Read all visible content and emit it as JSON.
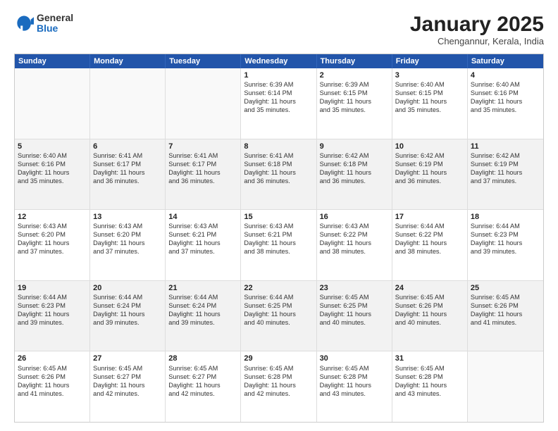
{
  "logo": {
    "general": "General",
    "blue": "Blue"
  },
  "header": {
    "month": "January 2025",
    "location": "Chengannur, Kerala, India"
  },
  "weekdays": [
    "Sunday",
    "Monday",
    "Tuesday",
    "Wednesday",
    "Thursday",
    "Friday",
    "Saturday"
  ],
  "rows": [
    [
      {
        "day": "",
        "info": ""
      },
      {
        "day": "",
        "info": ""
      },
      {
        "day": "",
        "info": ""
      },
      {
        "day": "1",
        "info": "Sunrise: 6:39 AM\nSunset: 6:14 PM\nDaylight: 11 hours\nand 35 minutes."
      },
      {
        "day": "2",
        "info": "Sunrise: 6:39 AM\nSunset: 6:15 PM\nDaylight: 11 hours\nand 35 minutes."
      },
      {
        "day": "3",
        "info": "Sunrise: 6:40 AM\nSunset: 6:15 PM\nDaylight: 11 hours\nand 35 minutes."
      },
      {
        "day": "4",
        "info": "Sunrise: 6:40 AM\nSunset: 6:16 PM\nDaylight: 11 hours\nand 35 minutes."
      }
    ],
    [
      {
        "day": "5",
        "info": "Sunrise: 6:40 AM\nSunset: 6:16 PM\nDaylight: 11 hours\nand 35 minutes."
      },
      {
        "day": "6",
        "info": "Sunrise: 6:41 AM\nSunset: 6:17 PM\nDaylight: 11 hours\nand 36 minutes."
      },
      {
        "day": "7",
        "info": "Sunrise: 6:41 AM\nSunset: 6:17 PM\nDaylight: 11 hours\nand 36 minutes."
      },
      {
        "day": "8",
        "info": "Sunrise: 6:41 AM\nSunset: 6:18 PM\nDaylight: 11 hours\nand 36 minutes."
      },
      {
        "day": "9",
        "info": "Sunrise: 6:42 AM\nSunset: 6:18 PM\nDaylight: 11 hours\nand 36 minutes."
      },
      {
        "day": "10",
        "info": "Sunrise: 6:42 AM\nSunset: 6:19 PM\nDaylight: 11 hours\nand 36 minutes."
      },
      {
        "day": "11",
        "info": "Sunrise: 6:42 AM\nSunset: 6:19 PM\nDaylight: 11 hours\nand 37 minutes."
      }
    ],
    [
      {
        "day": "12",
        "info": "Sunrise: 6:43 AM\nSunset: 6:20 PM\nDaylight: 11 hours\nand 37 minutes."
      },
      {
        "day": "13",
        "info": "Sunrise: 6:43 AM\nSunset: 6:20 PM\nDaylight: 11 hours\nand 37 minutes."
      },
      {
        "day": "14",
        "info": "Sunrise: 6:43 AM\nSunset: 6:21 PM\nDaylight: 11 hours\nand 37 minutes."
      },
      {
        "day": "15",
        "info": "Sunrise: 6:43 AM\nSunset: 6:21 PM\nDaylight: 11 hours\nand 38 minutes."
      },
      {
        "day": "16",
        "info": "Sunrise: 6:43 AM\nSunset: 6:22 PM\nDaylight: 11 hours\nand 38 minutes."
      },
      {
        "day": "17",
        "info": "Sunrise: 6:44 AM\nSunset: 6:22 PM\nDaylight: 11 hours\nand 38 minutes."
      },
      {
        "day": "18",
        "info": "Sunrise: 6:44 AM\nSunset: 6:23 PM\nDaylight: 11 hours\nand 39 minutes."
      }
    ],
    [
      {
        "day": "19",
        "info": "Sunrise: 6:44 AM\nSunset: 6:23 PM\nDaylight: 11 hours\nand 39 minutes."
      },
      {
        "day": "20",
        "info": "Sunrise: 6:44 AM\nSunset: 6:24 PM\nDaylight: 11 hours\nand 39 minutes."
      },
      {
        "day": "21",
        "info": "Sunrise: 6:44 AM\nSunset: 6:24 PM\nDaylight: 11 hours\nand 39 minutes."
      },
      {
        "day": "22",
        "info": "Sunrise: 6:44 AM\nSunset: 6:25 PM\nDaylight: 11 hours\nand 40 minutes."
      },
      {
        "day": "23",
        "info": "Sunrise: 6:45 AM\nSunset: 6:25 PM\nDaylight: 11 hours\nand 40 minutes."
      },
      {
        "day": "24",
        "info": "Sunrise: 6:45 AM\nSunset: 6:26 PM\nDaylight: 11 hours\nand 40 minutes."
      },
      {
        "day": "25",
        "info": "Sunrise: 6:45 AM\nSunset: 6:26 PM\nDaylight: 11 hours\nand 41 minutes."
      }
    ],
    [
      {
        "day": "26",
        "info": "Sunrise: 6:45 AM\nSunset: 6:26 PM\nDaylight: 11 hours\nand 41 minutes."
      },
      {
        "day": "27",
        "info": "Sunrise: 6:45 AM\nSunset: 6:27 PM\nDaylight: 11 hours\nand 42 minutes."
      },
      {
        "day": "28",
        "info": "Sunrise: 6:45 AM\nSunset: 6:27 PM\nDaylight: 11 hours\nand 42 minutes."
      },
      {
        "day": "29",
        "info": "Sunrise: 6:45 AM\nSunset: 6:28 PM\nDaylight: 11 hours\nand 42 minutes."
      },
      {
        "day": "30",
        "info": "Sunrise: 6:45 AM\nSunset: 6:28 PM\nDaylight: 11 hours\nand 43 minutes."
      },
      {
        "day": "31",
        "info": "Sunrise: 6:45 AM\nSunset: 6:28 PM\nDaylight: 11 hours\nand 43 minutes."
      },
      {
        "day": "",
        "info": ""
      }
    ]
  ]
}
